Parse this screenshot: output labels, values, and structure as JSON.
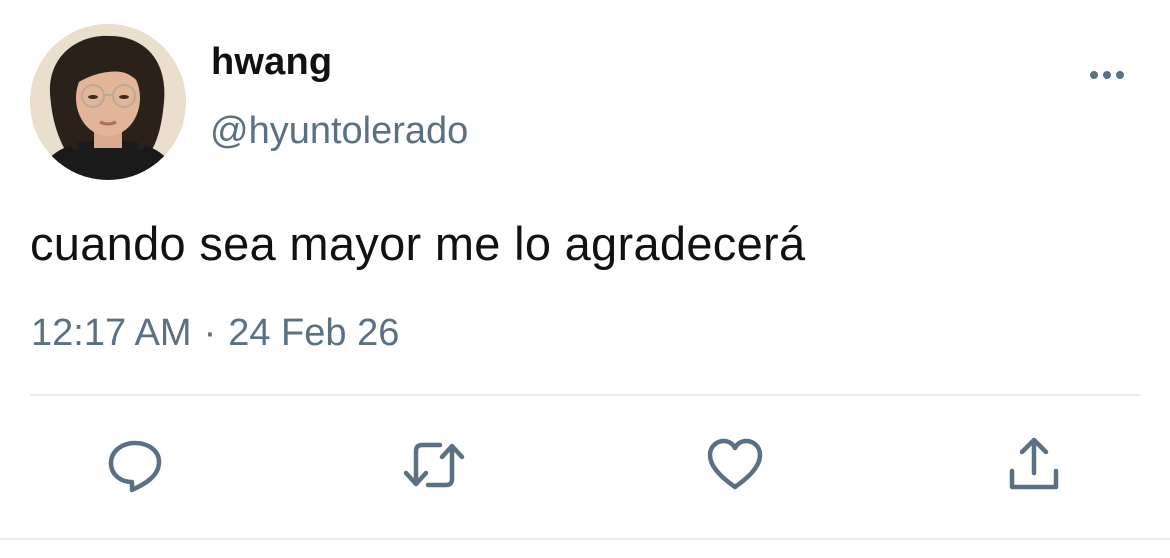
{
  "tweet": {
    "display_name": "hwang",
    "handle": "@hyuntolerado",
    "text": "cuando sea mayor me lo agradecerá",
    "time": "12:17 AM",
    "separator": "·",
    "date": "24 Feb 26"
  },
  "actions": {
    "reply_icon": "speech-bubble-icon",
    "retweet_icon": "retweet-icon",
    "like_icon": "heart-icon",
    "share_icon": "share-upload-icon"
  },
  "colors": {
    "text": "#111111",
    "secondary": "#5b7083",
    "divider": "#e6ecf0"
  }
}
